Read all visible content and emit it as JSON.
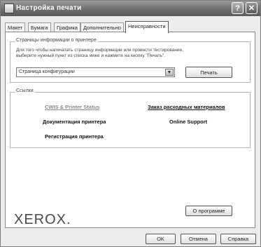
{
  "window": {
    "title": "Настройка печати"
  },
  "titlebar": {
    "help_glyph": "?",
    "close_glyph": "✕"
  },
  "tabs": [
    {
      "label": "Макет"
    },
    {
      "label": "Бумага"
    },
    {
      "label": "Графика"
    },
    {
      "label": "Дополнительно"
    },
    {
      "label": "Неисправности",
      "active": true
    }
  ],
  "info_pages": {
    "title": "Страницы информации о принтере",
    "description_line1": "Для того чтобы напечатать страницу информации или провести тестирование,",
    "description_line2": "выберите нужный пункт из списка ниже и нажмите на кнопку \"Печать\".",
    "select_value": "Страница конфигурации",
    "print_button": "Печать"
  },
  "links": {
    "title": "Ссылки",
    "cws": "CWIS & Printer Status",
    "supplies": "Заказ расходных материалов",
    "documentation": "Документация принтера",
    "support": "Online Support",
    "registration": "Регистрация принтера"
  },
  "about_button": "О программе",
  "logo_text": "XEROX.",
  "footer": {
    "ok": "OK",
    "cancel": "Отмена",
    "help": "Справка"
  }
}
